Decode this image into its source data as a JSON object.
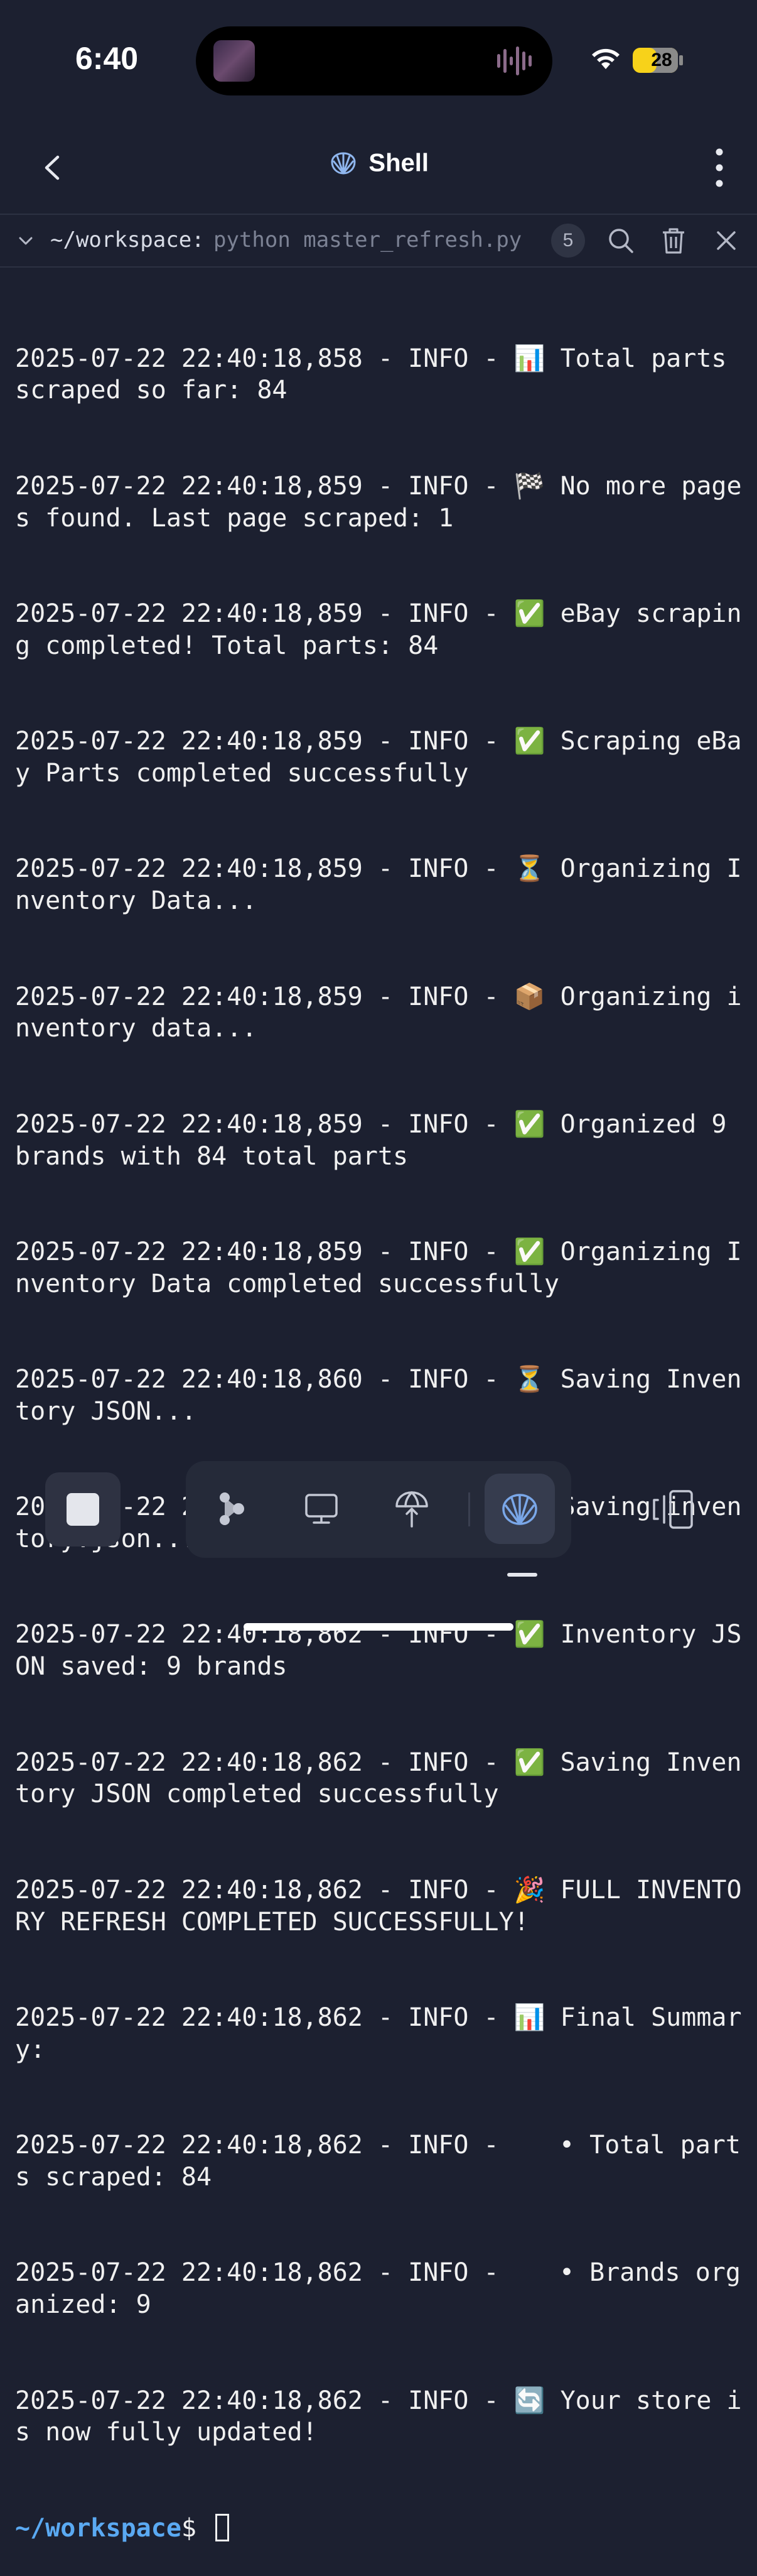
{
  "status_bar": {
    "time": "6:40",
    "battery": "28"
  },
  "header": {
    "title": "Shell"
  },
  "tab_bar": {
    "path": "~/workspace:",
    "command": "python master_refresh.py",
    "count": "5"
  },
  "terminal": {
    "lines": [
      "2025-07-22 22:40:18,858 - INFO - 📊 Total parts scraped so far: 84",
      "2025-07-22 22:40:18,859 - INFO - 🏁 No more pages found. Last page scraped: 1",
      "2025-07-22 22:40:18,859 - INFO - ✅ eBay scraping completed! Total parts: 84",
      "2025-07-22 22:40:18,859 - INFO - ✅ Scraping eBay Parts completed successfully",
      "2025-07-22 22:40:18,859 - INFO - ⏳ Organizing Inventory Data...",
      "2025-07-22 22:40:18,859 - INFO - 📦 Organizing inventory data...",
      "2025-07-22 22:40:18,859 - INFO - ✅ Organized 9 brands with 84 total parts",
      "2025-07-22 22:40:18,859 - INFO - ✅ Organizing Inventory Data completed successfully",
      "2025-07-22 22:40:18,860 - INFO - ⏳ Saving Inventory JSON...",
      "2025-07-22 22:40:18,860 - INFO - 💾 Saving inventory.json...",
      "2025-07-22 22:40:18,862 - INFO - ✅ Inventory JSON saved: 9 brands",
      "2025-07-22 22:40:18,862 - INFO - ✅ Saving Inventory JSON completed successfully",
      "2025-07-22 22:40:18,862 - INFO - 🎉 FULL INVENTORY REFRESH COMPLETED SUCCESSFULLY!",
      "2025-07-22 22:40:18,862 - INFO - 📊 Final Summary:",
      "2025-07-22 22:40:18,862 - INFO -    • Total parts scraped: 84",
      "2025-07-22 22:40:18,862 - INFO -    • Brands organized: 9",
      "2025-07-22 22:40:18,862 - INFO - 🔄 Your store is now fully updated!"
    ],
    "prompt_path": "~/workspace",
    "prompt_symbol": "$"
  },
  "colors": {
    "background": "#1c2030",
    "prompt": "#5aa9f2",
    "accent": "#7aa7e8"
  },
  "icons": {
    "back": "chevron-left-icon",
    "title": "shell-icon",
    "menu": "more-vertical-icon",
    "search": "search-icon",
    "trash": "trash-icon",
    "close": "close-icon",
    "stop": "stop-icon",
    "agent": "agent-icon",
    "console": "monitor-icon",
    "deploy": "deploy-icon",
    "shell": "shell-icon",
    "panels": "panels-icon"
  }
}
